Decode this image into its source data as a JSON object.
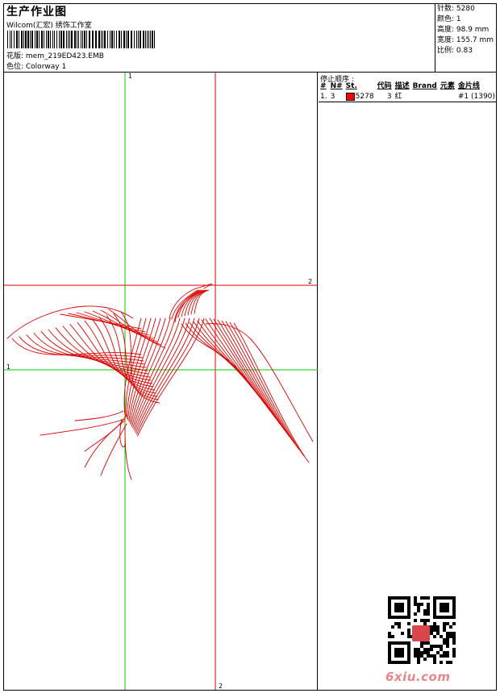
{
  "header": {
    "title": "生产作业图",
    "company": "Wilcom(汇宏) 绣饰工作室",
    "design": "花版: mem_219ED423.EMB",
    "colorway": "色位: Colorway 1"
  },
  "stats": [
    "针数: 5280",
    "颜色: 1",
    "高度: 98.9 mm",
    "宽度: 155.7 mm",
    "比例: 0.83"
  ],
  "stop_sequence": {
    "title": "停止顺序 :",
    "columns": [
      "#",
      "N#",
      "St.",
      "代码",
      "描述",
      "Brand",
      "元素",
      "金片线"
    ],
    "rows": [
      {
        "index": "1.",
        "needle": "3",
        "stitches": "5278",
        "code": "3",
        "description": "红",
        "brand": "",
        "element": "",
        "sequin": "#1 (1390)"
      }
    ]
  },
  "guides": {
    "vertical_1_label": "1",
    "vertical_2_label": "2",
    "horizontal_1_label": "1",
    "horizontal_2_label": "2"
  },
  "watermark": {
    "text": "6xiu.com",
    "seal_text": "绣花\n图案"
  },
  "colors": {
    "thread": "#dd0000",
    "guide_green": "#00cc00",
    "guide_red": "#dd0000",
    "swatch": "#ff0000"
  }
}
